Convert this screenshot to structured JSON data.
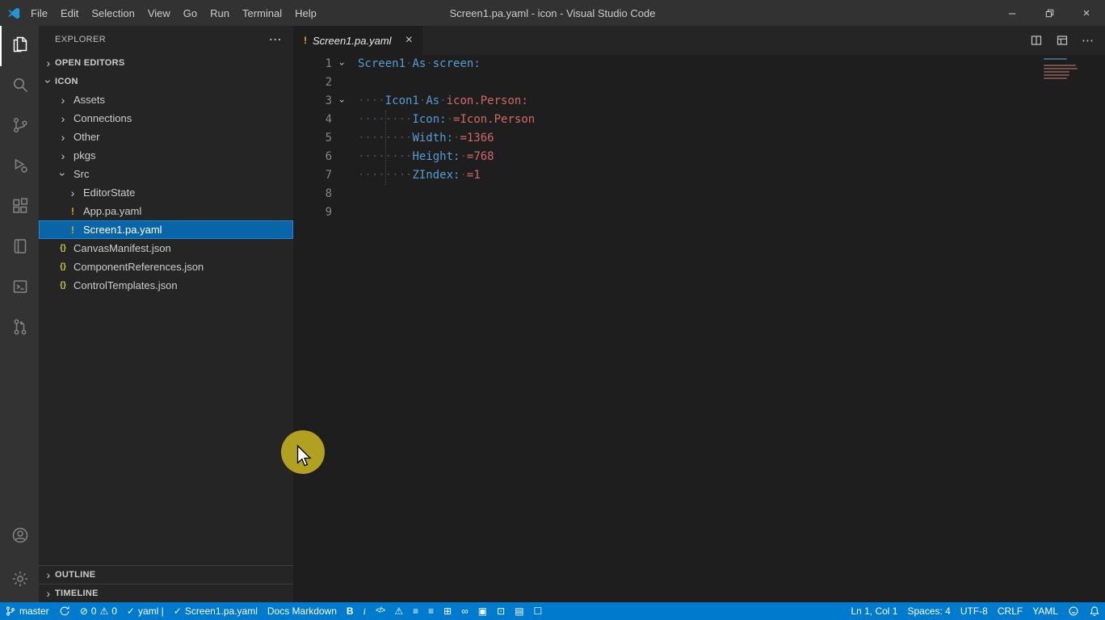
{
  "window": {
    "title": "Screen1.pa.yaml - icon - Visual Studio Code",
    "menus": [
      "File",
      "Edit",
      "Selection",
      "View",
      "Go",
      "Run",
      "Terminal",
      "Help"
    ]
  },
  "glyphs": {
    "chevron": "›",
    "more": "⋯",
    "minimize": "–",
    "close": "×",
    "yaml-file": "!",
    "json-file": "{}",
    "bold": "B",
    "italic": "i",
    "code": "</>",
    "warning": "⚠",
    "error": "⊘",
    "check": "✓",
    "ordered-list": "≡",
    "bullet-list": "≡",
    "add-box": "⊞",
    "link": "∞",
    "export": "▣",
    "lock": "⊡",
    "doc": "▤",
    "table": "☐"
  },
  "activity_bar": {
    "top": [
      {
        "name": "explorer",
        "active": true
      },
      {
        "name": "search"
      },
      {
        "name": "source-control"
      },
      {
        "name": "run-and-debug"
      },
      {
        "name": "extensions"
      },
      {
        "name": "notebook"
      },
      {
        "name": "terminal"
      },
      {
        "name": "pull-requests"
      }
    ],
    "bottom": [
      {
        "name": "account"
      },
      {
        "name": "settings"
      }
    ]
  },
  "sidebar": {
    "title": "EXPLORER",
    "sections": {
      "open_editors": "OPEN EDITORS",
      "root": "ICON",
      "outline": "OUTLINE",
      "timeline": "TIMELINE"
    },
    "tree": [
      {
        "label": "Assets",
        "icon": "chevron-right",
        "level": 1
      },
      {
        "label": "Connections",
        "icon": "chevron-right",
        "level": 1
      },
      {
        "label": "Other",
        "icon": "chevron-right",
        "level": 1
      },
      {
        "label": "pkgs",
        "icon": "chevron-right",
        "level": 1
      },
      {
        "label": "Src",
        "icon": "chevron-down",
        "level": 1
      },
      {
        "label": "EditorState",
        "icon": "chevron-right",
        "level": 2
      },
      {
        "label": "App.pa.yaml",
        "icon": "yaml-file",
        "level": 2
      },
      {
        "label": "Screen1.pa.yaml",
        "icon": "yaml-file",
        "level": 2,
        "selected": true
      },
      {
        "label": "CanvasManifest.json",
        "icon": "json-file",
        "level": 1
      },
      {
        "label": "ComponentReferences.json",
        "icon": "json-file",
        "level": 1
      },
      {
        "label": "ControlTemplates.json",
        "icon": "json-file",
        "level": 1
      }
    ]
  },
  "editor": {
    "tab": {
      "label": "Screen1.pa.yaml",
      "icon": "yaml-file",
      "close_glyph": "×"
    },
    "actions": [
      {
        "name": "split-editor"
      },
      {
        "name": "customize-layout"
      },
      {
        "name": "more-actions",
        "glyph": "more"
      }
    ],
    "lines": [
      {
        "n": "1",
        "fold": true,
        "tokens": [
          [
            "id",
            "Screen1"
          ],
          [
            "ws",
            "·"
          ],
          [
            "kw",
            "As"
          ],
          [
            "ws",
            "·"
          ],
          [
            "id",
            "screen:"
          ]
        ]
      },
      {
        "n": "2",
        "tokens": []
      },
      {
        "n": "3",
        "fold": true,
        "tokens": [
          [
            "ws",
            "····"
          ],
          [
            "id",
            "Icon1"
          ],
          [
            "ws",
            "·"
          ],
          [
            "kw",
            "As"
          ],
          [
            "ws",
            "·"
          ],
          [
            "val",
            "icon.Person:"
          ]
        ]
      },
      {
        "n": "4",
        "tokens": [
          [
            "ws",
            "········"
          ],
          [
            "id",
            "Icon:"
          ],
          [
            "ws",
            "·"
          ],
          [
            "val",
            "=Icon.Person"
          ]
        ]
      },
      {
        "n": "5",
        "tokens": [
          [
            "ws",
            "········"
          ],
          [
            "id",
            "Width:"
          ],
          [
            "ws",
            "·"
          ],
          [
            "val",
            "=1366"
          ]
        ]
      },
      {
        "n": "6",
        "tokens": [
          [
            "ws",
            "········"
          ],
          [
            "id",
            "Height:"
          ],
          [
            "ws",
            "·"
          ],
          [
            "val",
            "=768"
          ]
        ]
      },
      {
        "n": "7",
        "tokens": [
          [
            "ws",
            "········"
          ],
          [
            "id",
            "ZIndex:"
          ],
          [
            "ws",
            "·"
          ],
          [
            "val",
            "=1"
          ]
        ]
      },
      {
        "n": "8",
        "tokens": []
      },
      {
        "n": "9",
        "tokens": []
      }
    ]
  },
  "status_bar": {
    "left": [
      {
        "name": "git-branch-status",
        "parts": [
          {
            "icon": "branch"
          },
          {
            "text": "master"
          }
        ]
      },
      {
        "name": "sync-status",
        "parts": [
          {
            "icon": "sync"
          }
        ]
      },
      {
        "name": "problems-status",
        "parts": [
          {
            "icon": "error"
          },
          {
            "text": "0"
          },
          {
            "icon": "warning"
          },
          {
            "text": "0"
          }
        ]
      },
      {
        "name": "yaml-status",
        "parts": [
          {
            "icon": "check"
          },
          {
            "text": "yaml |"
          }
        ]
      },
      {
        "name": "schema-status",
        "parts": [
          {
            "icon": "check"
          },
          {
            "text": "Screen1.pa.yaml"
          }
        ]
      },
      {
        "name": "docs-markdown-status",
        "parts": [
          {
            "text": "Docs Markdown"
          }
        ]
      },
      {
        "name": "bold-button",
        "parts": [
          {
            "icon": "bold"
          }
        ]
      },
      {
        "name": "italic-button",
        "parts": [
          {
            "icon": "italic"
          }
        ]
      },
      {
        "name": "code-button",
        "parts": [
          {
            "icon": "code"
          }
        ]
      },
      {
        "name": "alert-button",
        "parts": [
          {
            "icon": "warning"
          }
        ]
      },
      {
        "name": "numbered-list-button",
        "parts": [
          {
            "icon": "ordered-list"
          }
        ]
      },
      {
        "name": "bullet-list-button",
        "parts": [
          {
            "icon": "bullet-list"
          }
        ]
      },
      {
        "name": "checkbox-button",
        "parts": [
          {
            "icon": "add-box"
          }
        ]
      },
      {
        "name": "link-button",
        "parts": [
          {
            "icon": "link"
          }
        ]
      },
      {
        "name": "image-button",
        "parts": [
          {
            "icon": "export"
          }
        ]
      },
      {
        "name": "lock-button",
        "parts": [
          {
            "icon": "lock"
          }
        ]
      },
      {
        "name": "preview-button",
        "parts": [
          {
            "icon": "doc"
          }
        ]
      },
      {
        "name": "table-button",
        "parts": [
          {
            "icon": "table"
          }
        ]
      }
    ],
    "right": [
      {
        "name": "cursor-position",
        "parts": [
          {
            "text": "Ln 1, Col 1"
          }
        ]
      },
      {
        "name": "indentation",
        "parts": [
          {
            "text": "Spaces: 4"
          }
        ]
      },
      {
        "name": "encoding",
        "parts": [
          {
            "text": "UTF-8"
          }
        ]
      },
      {
        "name": "eol-sequence",
        "parts": [
          {
            "text": "CRLF"
          }
        ]
      },
      {
        "name": "language-mode",
        "parts": [
          {
            "text": "YAML"
          }
        ]
      },
      {
        "name": "feedback",
        "parts": [
          {
            "icon": "feedback"
          }
        ]
      },
      {
        "name": "notifications",
        "parts": [
          {
            "icon": "bell"
          }
        ]
      }
    ]
  }
}
